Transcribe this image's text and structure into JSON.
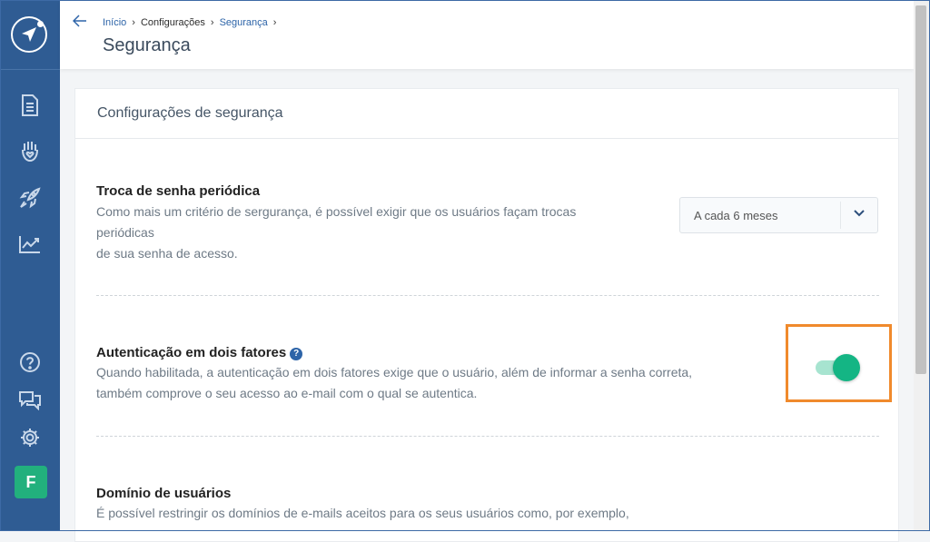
{
  "colors": {
    "sidebar_bg": "#2f5c93",
    "accent": "#2d64a8",
    "toggle_on": "#14b584",
    "avatar_bg": "#22b07d",
    "highlight": "#f08a2c"
  },
  "sidebar": {
    "items": [
      {
        "icon": "document-icon"
      },
      {
        "icon": "hand-heart-icon"
      },
      {
        "icon": "rocket-icon"
      },
      {
        "icon": "chart-line-icon"
      }
    ],
    "bottom": [
      {
        "icon": "help-circle-icon"
      },
      {
        "icon": "chat-icon"
      },
      {
        "icon": "gear-icon"
      }
    ],
    "avatar_letter": "F"
  },
  "header": {
    "breadcrumb": {
      "home": "Início",
      "settings": "Configurações",
      "current": "Segurança"
    },
    "title": "Segurança"
  },
  "card": {
    "title": "Configurações de segurança",
    "sections": {
      "password": {
        "title": "Troca de senha periódica",
        "desc_line1": "Como mais um critério de sergurança, é possível exigir que os usuários façam trocas",
        "desc_line2": "periódicas",
        "desc_line3": "de sua senha de acesso.",
        "select_value": "A cada 6 meses"
      },
      "twofactor": {
        "title": "Autenticação em dois fatores",
        "help": "?",
        "desc_line1": "Quando habilitada, a autenticação em dois fatores exige que o usuário, além de informar a senha correta,",
        "desc_line2": "também comprove o seu acesso ao e-mail com o qual se autentica.",
        "enabled": true
      },
      "domain": {
        "title": "Domínio de usuários",
        "desc_line1": "É possível restringir os domínios de e-mails aceitos para os seus usuários como, por exemplo,"
      }
    }
  }
}
